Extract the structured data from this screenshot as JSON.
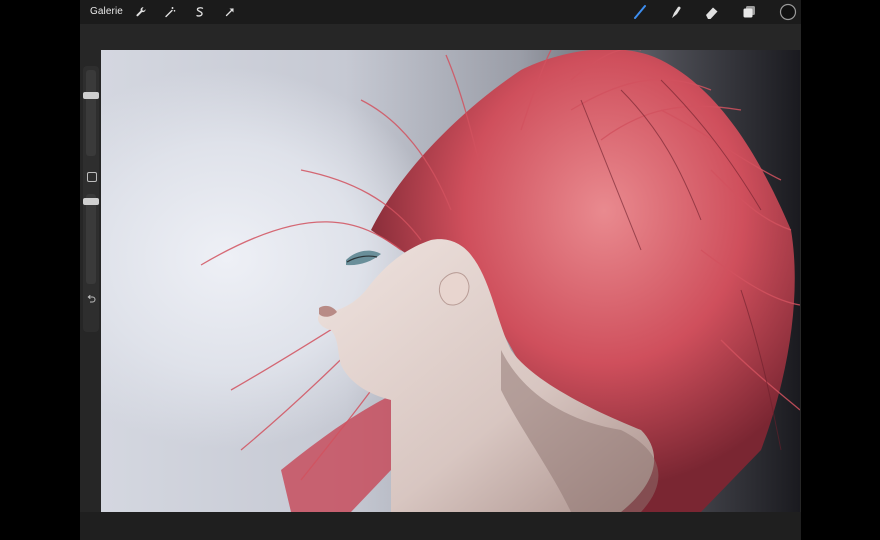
{
  "topbar": {
    "gallery_label": "Galerie",
    "left_tools": [
      {
        "name": "wrench-icon"
      },
      {
        "name": "magic-wand-icon"
      },
      {
        "name": "selection-icon"
      },
      {
        "name": "transform-arrow-icon"
      }
    ],
    "right_tools": [
      {
        "name": "brush-icon",
        "active": true
      },
      {
        "name": "smudge-icon"
      },
      {
        "name": "eraser-icon"
      },
      {
        "name": "layers-icon"
      },
      {
        "name": "color-swatch",
        "color": "#111111"
      }
    ]
  },
  "sidebar": {
    "brush_size_level": 0.1,
    "opacity_level": 0.1,
    "modify_button": "square-icon",
    "undo_icon": "undo-arrow-icon"
  },
  "canvas": {
    "image": "woman-with-windswept-red-hair",
    "colors": {
      "hair": "#d9606a",
      "background": "#d6d8e0",
      "skin": "#e6d6d2"
    }
  }
}
